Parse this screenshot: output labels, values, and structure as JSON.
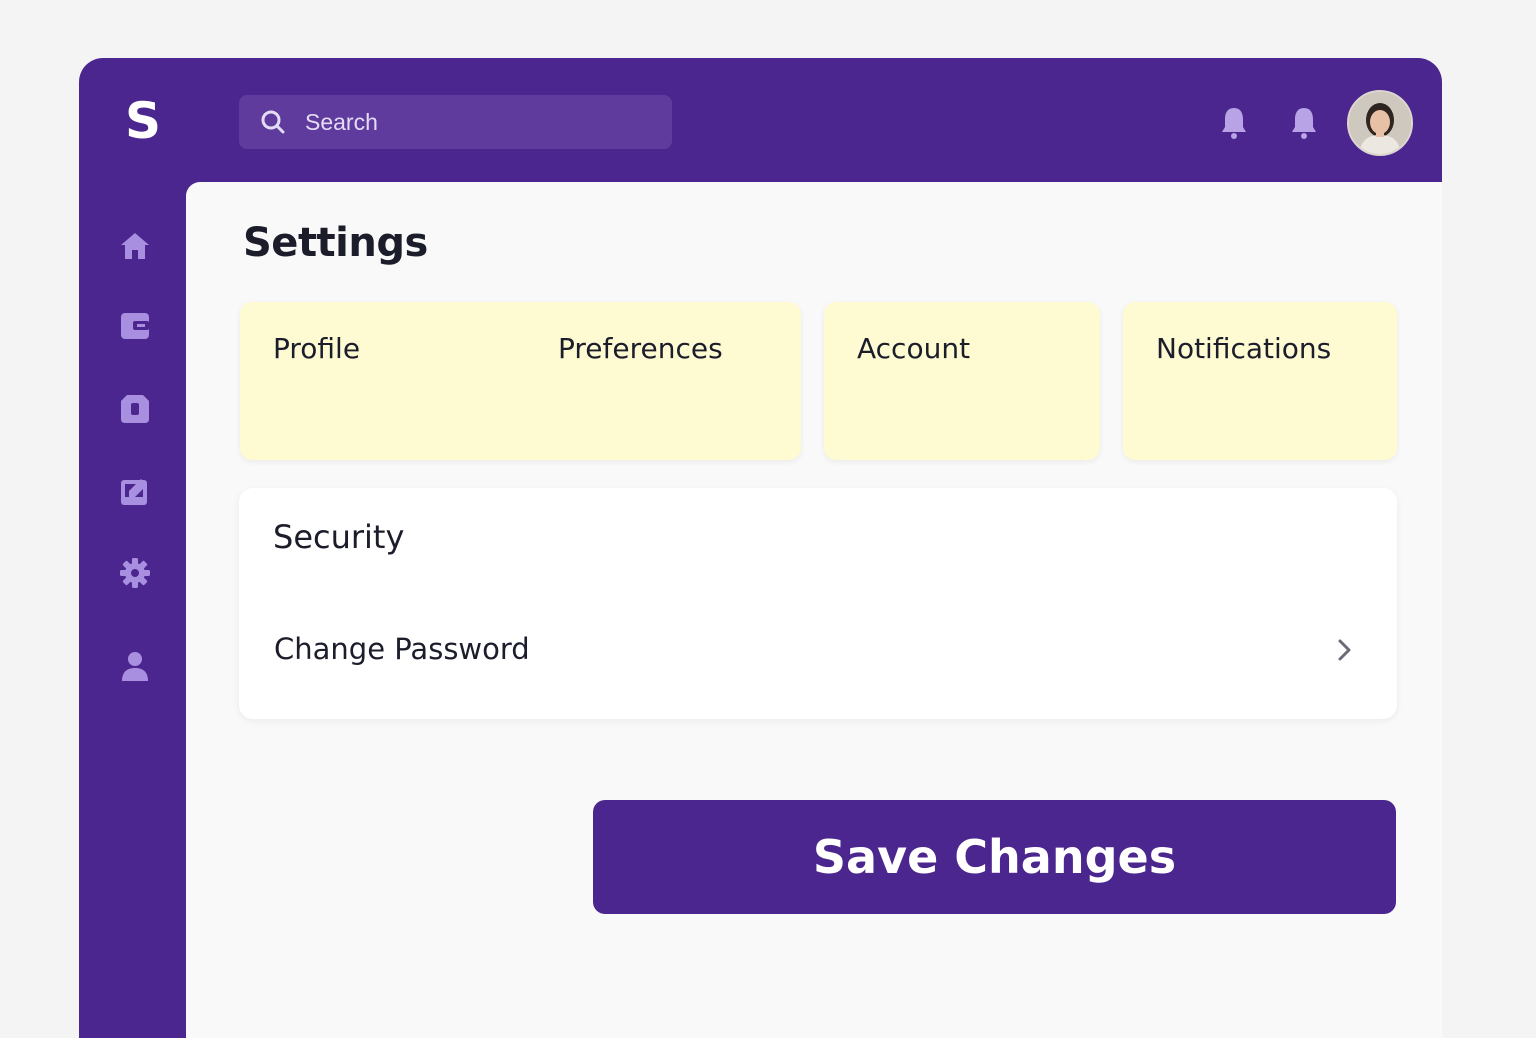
{
  "app": {
    "logo_letter": "S",
    "brand_color": "#4c268f"
  },
  "header": {
    "search": {
      "placeholder": "Search",
      "icon": "search-icon"
    },
    "icons": [
      "bell-icon",
      "bell-icon"
    ],
    "avatar": "user-avatar"
  },
  "sidebar": {
    "items": [
      {
        "icon": "home-icon"
      },
      {
        "icon": "wallet-icon"
      },
      {
        "icon": "document-icon"
      },
      {
        "icon": "edit-icon"
      },
      {
        "icon": "gear-icon"
      },
      {
        "icon": "user-icon"
      }
    ]
  },
  "main": {
    "title": "Settings",
    "tabs": [
      {
        "label": "Profile"
      },
      {
        "label": "Preferences"
      },
      {
        "label": "Account"
      },
      {
        "label": "Notifications"
      }
    ],
    "tab_color": "#fefad2",
    "security": {
      "title": "Security",
      "rows": [
        {
          "label": "Change Password",
          "icon": "chevron-right-icon"
        }
      ]
    },
    "save_label": "Save Changes"
  }
}
